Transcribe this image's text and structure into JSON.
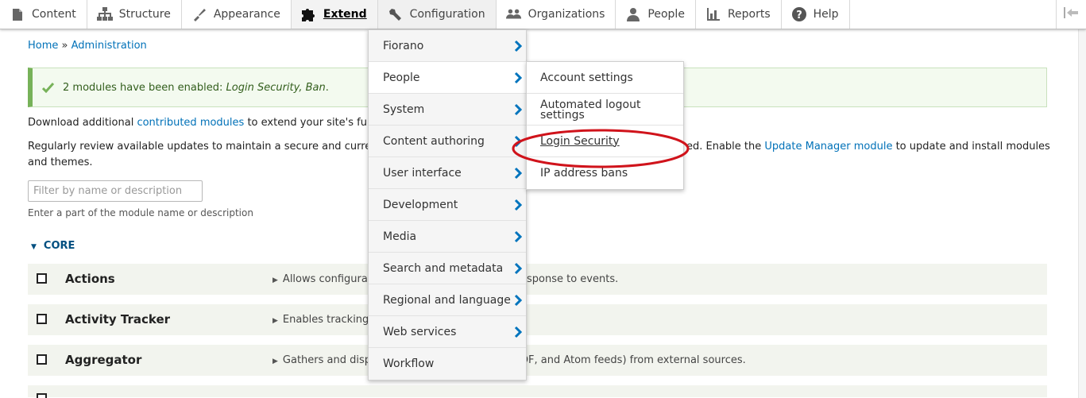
{
  "toolbar": {
    "items": [
      {
        "label": "Content",
        "icon": "page-icon"
      },
      {
        "label": "Structure",
        "icon": "sitemap-icon"
      },
      {
        "label": "Appearance",
        "icon": "paintbrush-icon"
      },
      {
        "label": "Extend",
        "icon": "puzzle-icon"
      },
      {
        "label": "Configuration",
        "icon": "wrench-icon"
      },
      {
        "label": "Organizations",
        "icon": "people-group-icon"
      },
      {
        "label": "People",
        "icon": "person-icon"
      },
      {
        "label": "Reports",
        "icon": "bar-chart-icon"
      },
      {
        "label": "Help",
        "icon": "question-icon"
      }
    ],
    "collapse_icon": "collapse-icon"
  },
  "breadcrumb": {
    "home": "Home",
    "separator": "»",
    "admin": "Administration"
  },
  "status": {
    "prefix": "2 modules have been enabled: ",
    "modules": "Login Security, Ban",
    "suffix": "."
  },
  "intro": {
    "line1_before": "Download additional ",
    "line1_link": "contributed modules",
    "line1_after": " to extend your site's func",
    "line2_before": "Regularly review available updates to maintain a secure and current",
    "line2_mid": "ed. Enable the ",
    "line2_link": "Update Manager module",
    "line2_after": " to update and install modules",
    "line3": "and themes."
  },
  "filter": {
    "placeholder": "Filter by name or description",
    "description": "Enter a part of the module name or description"
  },
  "core": {
    "label": "CORE"
  },
  "modules": [
    {
      "name": "Actions",
      "desc_left": "Allows configurat",
      "desc_right": "esponse to events."
    },
    {
      "name": "Activity Tracker",
      "desc_left": "Enables tracking",
      "desc_right": ""
    },
    {
      "name": "Aggregator",
      "desc_left": "Gathers and disp",
      "desc_right": "DF, and Atom feeds) from external sources."
    }
  ],
  "config_menu": [
    {
      "label": "Fiorano"
    },
    {
      "label": "People"
    },
    {
      "label": "System"
    },
    {
      "label": "Content authoring"
    },
    {
      "label": "User interface"
    },
    {
      "label": "Development"
    },
    {
      "label": "Media"
    },
    {
      "label": "Search and metadata"
    },
    {
      "label": "Regional and language"
    },
    {
      "label": "Web services"
    },
    {
      "label": "Workflow"
    }
  ],
  "people_submenu": [
    {
      "label": "Account settings"
    },
    {
      "label": "Automated logout settings"
    },
    {
      "label": "Login Security"
    },
    {
      "label": "IP address bans"
    }
  ],
  "colors": {
    "link": "#0071b8",
    "status_border": "#77b259",
    "highlight": "#d0131b"
  }
}
